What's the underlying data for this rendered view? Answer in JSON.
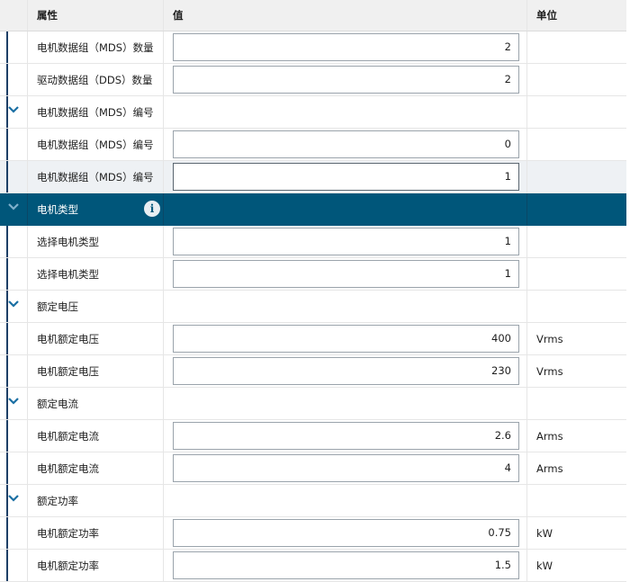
{
  "header": {
    "property": "属性",
    "value": "值",
    "unit": "单位"
  },
  "rows": [
    {
      "kind": "param",
      "label": "电机数据组（MDS）数量",
      "value": "2",
      "unit": ""
    },
    {
      "kind": "param",
      "label": "驱动数据组（DDS）数量",
      "value": "2",
      "unit": ""
    },
    {
      "kind": "group",
      "label": "电机数据组（MDS）编号"
    },
    {
      "kind": "param",
      "label": "电机数据组（MDS）编号",
      "value": "0",
      "unit": ""
    },
    {
      "kind": "param",
      "label": "电机数据组（MDS）编号",
      "value": "1",
      "unit": "",
      "highlighted": true
    },
    {
      "kind": "group",
      "label": "电机类型",
      "selected": true,
      "info_icon": "info-icon"
    },
    {
      "kind": "param",
      "label": "选择电机类型",
      "value": "1",
      "unit": ""
    },
    {
      "kind": "param",
      "label": "选择电机类型",
      "value": "1",
      "unit": ""
    },
    {
      "kind": "group",
      "label": "额定电压"
    },
    {
      "kind": "param",
      "label": "电机额定电压",
      "value": "400",
      "unit": "Vrms"
    },
    {
      "kind": "param",
      "label": "电机额定电压",
      "value": "230",
      "unit": "Vrms"
    },
    {
      "kind": "group",
      "label": "额定电流"
    },
    {
      "kind": "param",
      "label": "电机额定电流",
      "value": "2.6",
      "unit": "Arms"
    },
    {
      "kind": "param",
      "label": "电机额定电流",
      "value": "4",
      "unit": "Arms"
    },
    {
      "kind": "group",
      "label": "额定功率"
    },
    {
      "kind": "param",
      "label": "电机额定功率",
      "value": "0.75",
      "unit": "kW"
    },
    {
      "kind": "param",
      "label": "电机额定功率",
      "value": "1.5",
      "unit": "kW"
    }
  ],
  "colors": {
    "selected_group_bg": "#00567a",
    "accent_chevron": "#1a6fa3"
  }
}
